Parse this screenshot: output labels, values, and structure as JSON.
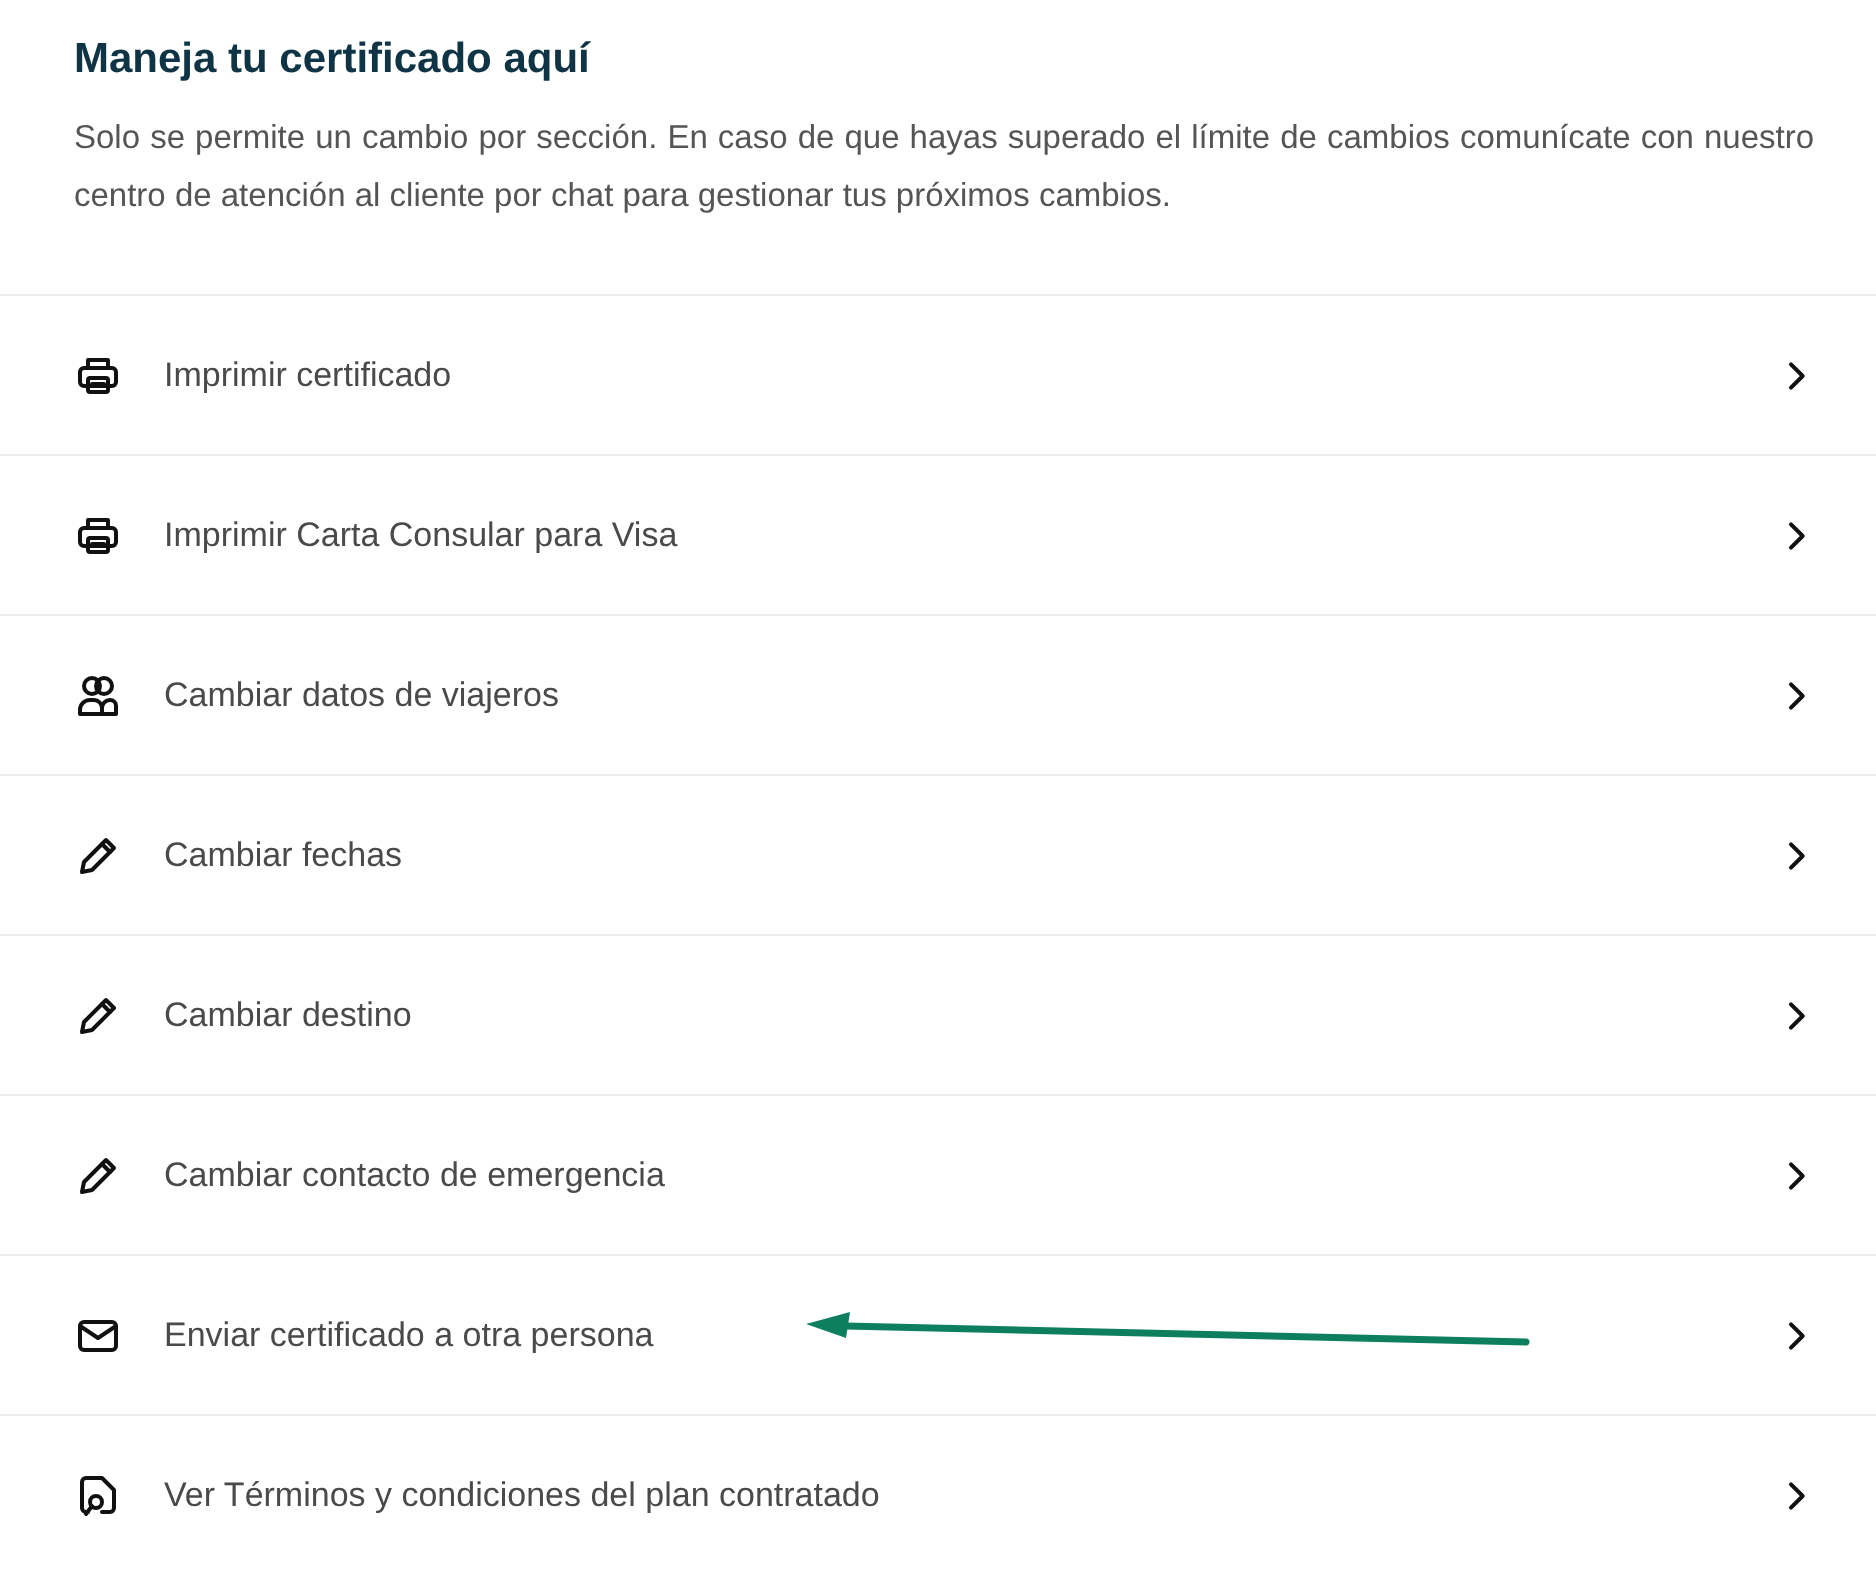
{
  "header": {
    "title": "Maneja tu certificado aquí",
    "description": "Solo se permite un cambio por sección. En caso de que hayas superado el límite de cambios comunícate con nuestro centro de atención al cliente por chat para gestionar tus próximos cambios."
  },
  "options": [
    {
      "kind": "printer",
      "label": "Imprimir certificado"
    },
    {
      "kind": "printer",
      "label": "Imprimir Carta Consular para Visa"
    },
    {
      "kind": "people",
      "label": "Cambiar datos de viajeros"
    },
    {
      "kind": "pencil",
      "label": "Cambiar fechas"
    },
    {
      "kind": "pencil",
      "label": "Cambiar destino"
    },
    {
      "kind": "pencil",
      "label": "Cambiar contacto de emergencia"
    },
    {
      "kind": "mail",
      "label": "Enviar certificado a otra persona"
    },
    {
      "kind": "document",
      "label": "Ver Términos y condiciones del plan contratado"
    }
  ]
}
